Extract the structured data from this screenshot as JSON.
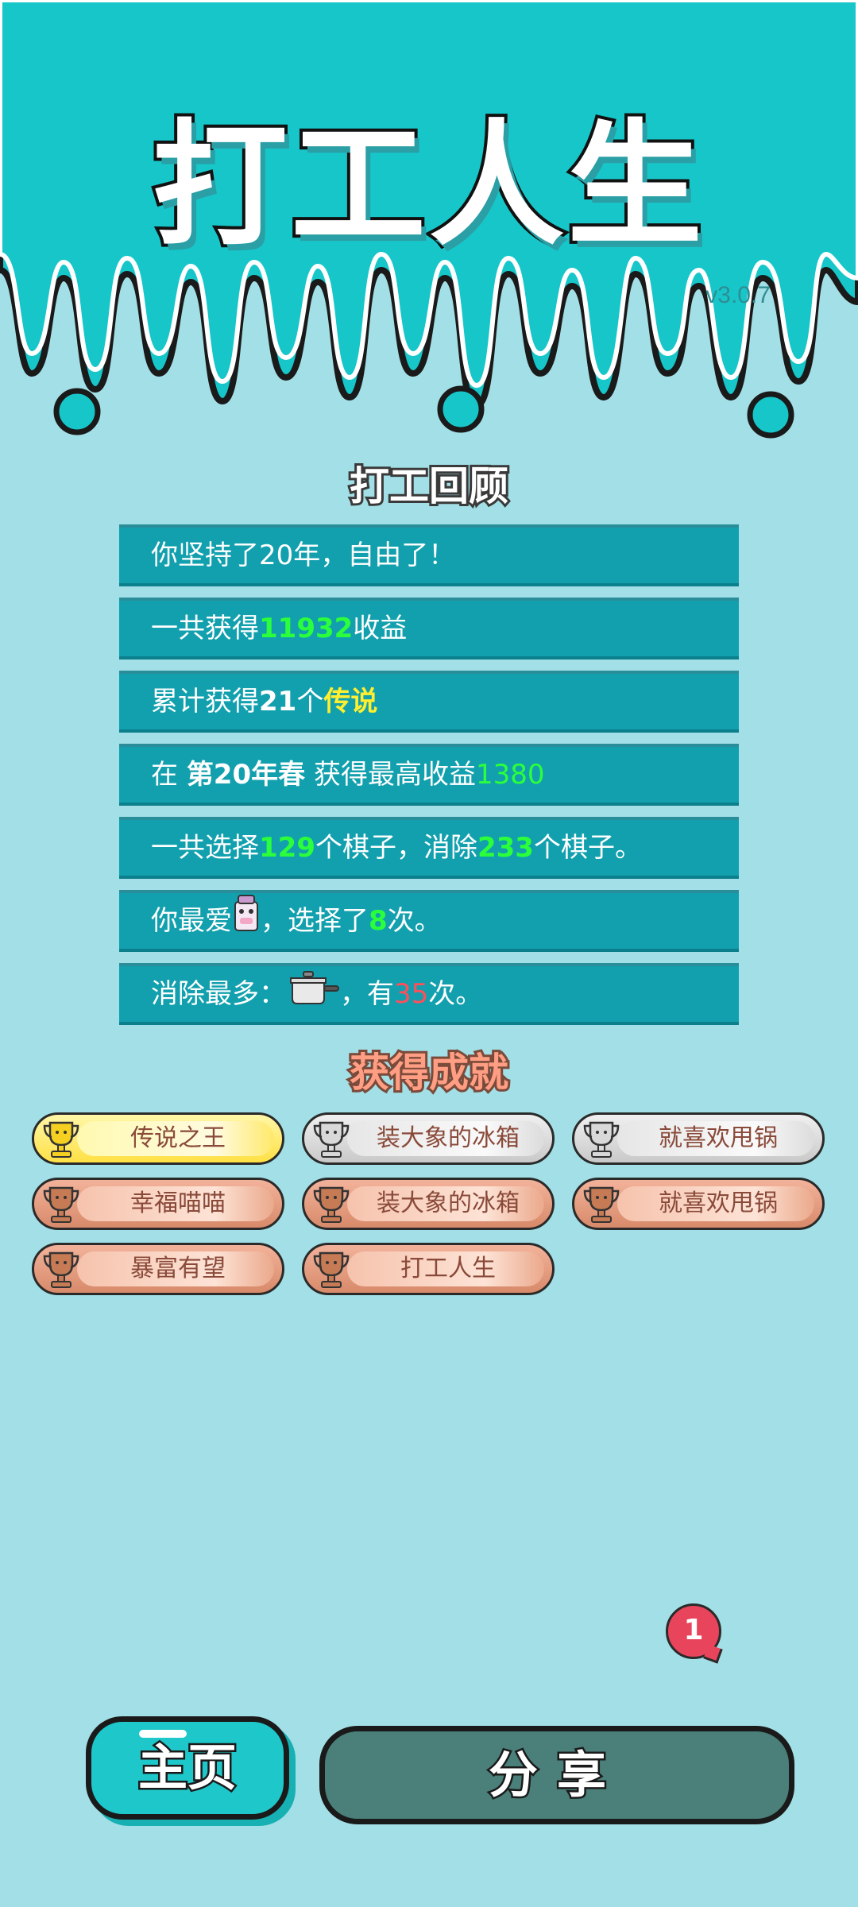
{
  "header": {
    "title": "打工人生",
    "version": "v3.0.7"
  },
  "review": {
    "title": "打工回顾",
    "rows": [
      {
        "pre": "你坚持了20年，自由了！"
      },
      {
        "pre": "一共获得",
        "num": "11932",
        "post": "收益"
      },
      {
        "pre": "累计获得",
        "num": "21",
        "mid": "个",
        "hl": "传说"
      },
      {
        "pre": "在 ",
        "bold": "第20年春",
        "mid": " 获得最高收益",
        "num": "1380"
      },
      {
        "pre": "一共选择",
        "num1": "129",
        "mid": "个棋子，消除",
        "num2": "233",
        "post": "个棋子。"
      },
      {
        "pre": "你最爱",
        "icon": "cow-piece-icon",
        "mid": "，选择了",
        "num": "8",
        "post": "次。"
      },
      {
        "pre": "消除最多：",
        "icon": "pot-piece-icon",
        "mid": "，有",
        "num": "35",
        "post": "次。"
      }
    ]
  },
  "achievements": {
    "title": "获得成就",
    "badges": [
      {
        "label": "传说之王",
        "tier": "gold"
      },
      {
        "label": "装大象的冰箱",
        "tier": "silver"
      },
      {
        "label": "就喜欢甩锅",
        "tier": "silver"
      },
      {
        "label": "幸福喵喵",
        "tier": "bronze"
      },
      {
        "label": "装大象的冰箱",
        "tier": "bronze"
      },
      {
        "label": "就喜欢甩锅",
        "tier": "bronze"
      },
      {
        "label": "暴富有望",
        "tier": "bronze"
      },
      {
        "label": "打工人生",
        "tier": "bronze"
      }
    ]
  },
  "notification": {
    "count": "1"
  },
  "buttons": {
    "home": "主页",
    "share": "分享"
  },
  "colors": {
    "background": "#a2dfe6",
    "header_teal": "#17c6c9",
    "row_bg": "#12a0ae",
    "highlight_green": "#2bff3b",
    "highlight_yellow": "#ffef2e",
    "highlight_red": "#ff4f5a"
  }
}
